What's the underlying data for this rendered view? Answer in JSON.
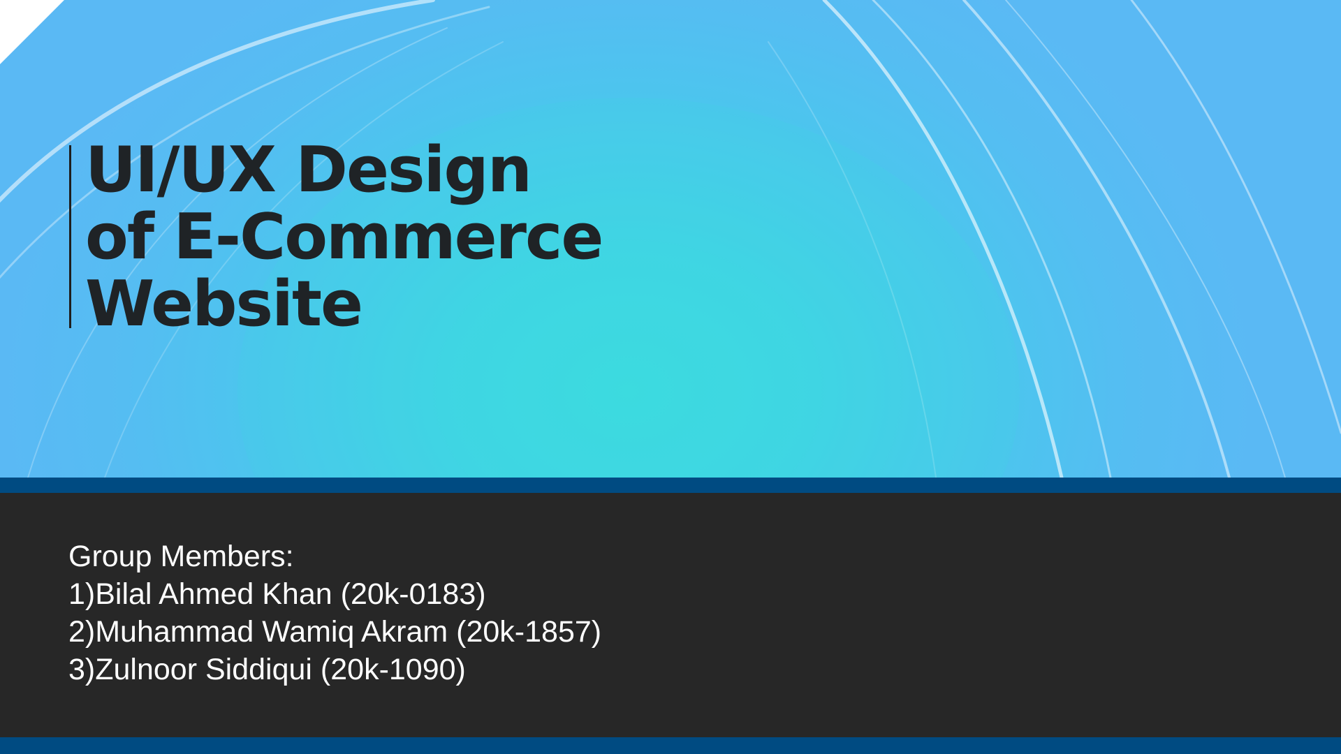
{
  "slide": {
    "title_lines": [
      "UI/UX Design",
      "of E-Commerce",
      "Website"
    ],
    "members_heading": "Group Members:",
    "members": [
      "1)Bilal Ahmed Khan (20k-0183)",
      "2)Muhammad Wamiq Akram (20k-1857)",
      "3)Zulnoor Siddiqui (20k-1090)"
    ]
  },
  "colors": {
    "hero_center": "#3ddbe0",
    "hero_edge": "#5ab9f4",
    "band": "#004b82",
    "footer_background": "#272727",
    "title_text": "#1f2326",
    "member_text": "#ffffff"
  }
}
